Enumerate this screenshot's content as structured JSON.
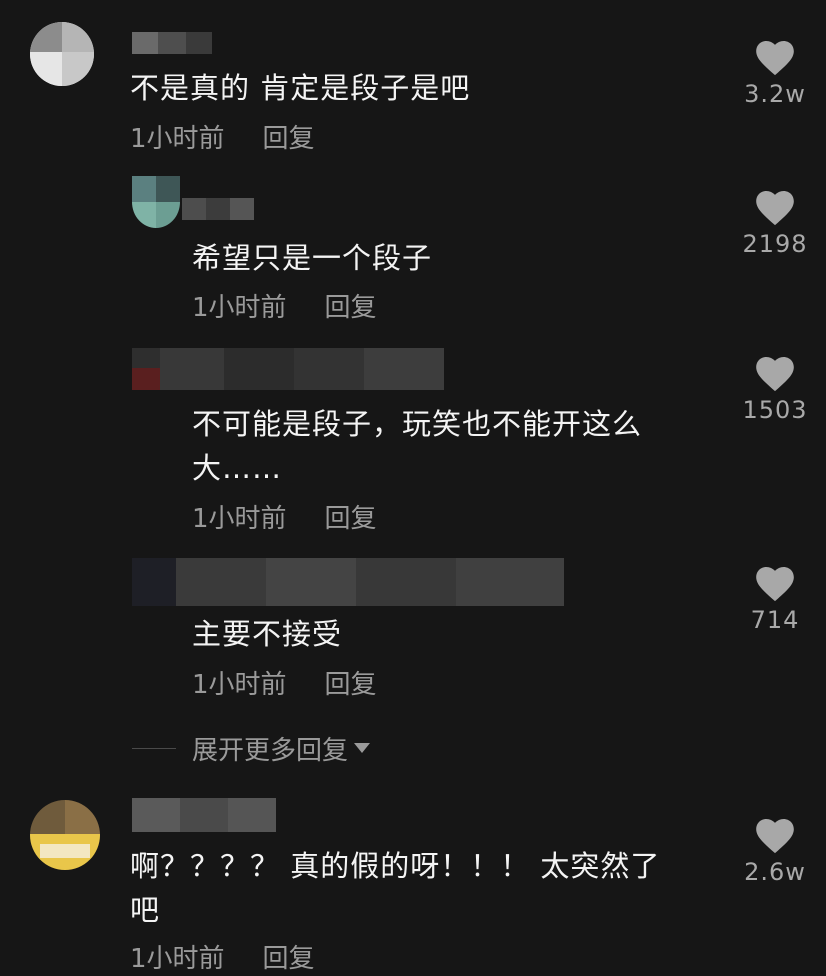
{
  "comments": [
    {
      "text": "不是真的 肯定是段子是吧",
      "time": "1小时前",
      "reply": "回复",
      "likes": "3.2w"
    },
    {
      "text": "希望只是一个段子",
      "time": "1小时前",
      "reply": "回复",
      "likes": "2198"
    },
    {
      "text": "不可能是段子，玩笑也不能开这么",
      "text_line2": "大……",
      "time": "1小时前",
      "reply": "回复",
      "likes": "1503"
    },
    {
      "text": "主要不接受",
      "time": "1小时前",
      "reply": "回复",
      "likes": "714"
    },
    {
      "text": "啊？？？？ 真的假的呀！！！ 太突然了",
      "text_line2": "吧",
      "time": "1小时前",
      "reply": "回复",
      "likes": "2.6w"
    }
  ],
  "expand_replies": "展开更多回复",
  "icons": {
    "like": "heart-icon",
    "expand": "caret-down-icon"
  },
  "colors": {
    "background": "#161616",
    "text": "#f4f4f4",
    "meta": "#9a9a9a",
    "heart": "#a8a8a8"
  }
}
